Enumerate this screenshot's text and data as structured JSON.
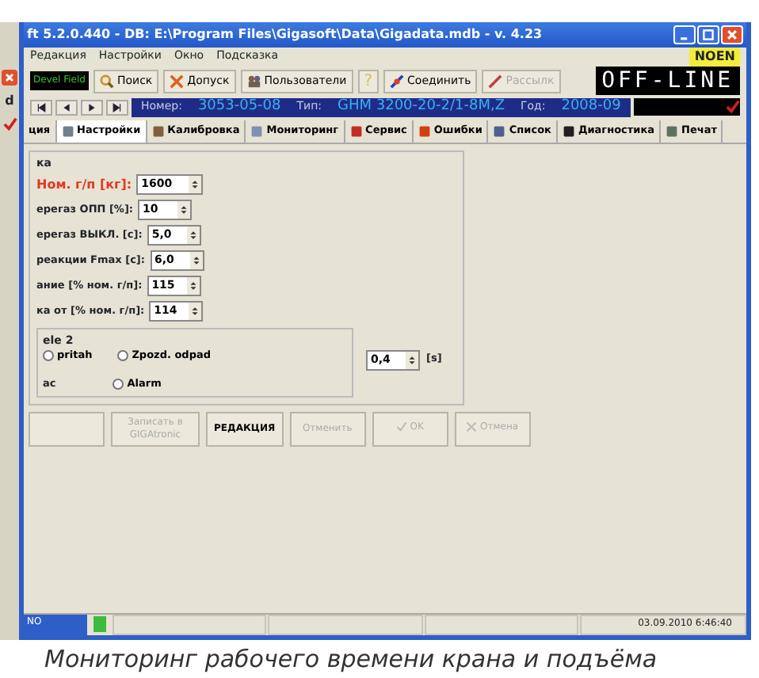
{
  "window": {
    "title": "ft 5.2.0.440 - DB: E:\\Program Files\\Gigasoft\\Data\\Gigadata.mdb - v. 4.23"
  },
  "background_window": {
    "text": "d"
  },
  "menu": [
    "Редакция",
    "Настройки",
    "Окно",
    "Подсказка"
  ],
  "badge": "NOEN",
  "toolbar": {
    "field": "Devel Field",
    "buttons": [
      {
        "label": "Поиск",
        "disabled": false
      },
      {
        "label": "Допуск",
        "disabled": false
      },
      {
        "label": "Пользователи",
        "disabled": false
      },
      {
        "label": "?",
        "disabled": true
      },
      {
        "label": "Соединить",
        "disabled": false
      },
      {
        "label": "Рассылк",
        "disabled": true
      }
    ]
  },
  "display": "OFF-LINE",
  "record": {
    "number_label": "Номер:",
    "number": "3053-05-08",
    "type_label": "Тип:",
    "type": "GHM 3200-20-2/1-8M,Z",
    "year_label": "Год:",
    "year": "2008-09"
  },
  "tabs": [
    {
      "label": "ция",
      "selected": false
    },
    {
      "label": "Настройки",
      "selected": true
    },
    {
      "label": "Калибровка",
      "selected": false
    },
    {
      "label": "Мониторинг",
      "selected": false
    },
    {
      "label": "Сервис",
      "selected": false
    },
    {
      "label": "Ошибки",
      "selected": false
    },
    {
      "label": "Список",
      "selected": false
    },
    {
      "label": "Диагностика",
      "selected": false
    },
    {
      "label": "Печат",
      "selected": false
    }
  ],
  "group": {
    "title": "ка",
    "fields": [
      {
        "label": "Ном. г/п [кг]:",
        "value": "1600",
        "highlight": true
      },
      {
        "label": "ерегаз ОПП [%]:",
        "value": "10",
        "highlight": false
      },
      {
        "label": "ерегаз ВЫКЛ. [с]:",
        "value": "5,0",
        "highlight": false
      },
      {
        "label": "реакции Fmax [с]:",
        "value": "6,0",
        "highlight": false
      },
      {
        "label": "ание [% ном. г/п]:",
        "value": "115",
        "highlight": false
      },
      {
        "label": "ка от [% ном. г/п]:",
        "value": "114",
        "highlight": false
      }
    ]
  },
  "relay": {
    "title": "ele 2",
    "row_label": "ac",
    "radios": [
      {
        "label": "pritah",
        "selected": false
      },
      {
        "label": "Zpozd. odpad",
        "selected": false
      },
      {
        "label": "Alarm",
        "selected": false
      }
    ],
    "delay": "0,4",
    "unit": "[s]"
  },
  "buttons": [
    {
      "label": "Записать в GIGAtronic",
      "disabled": true
    },
    {
      "label": "РЕДАКЦИЯ",
      "disabled": false
    },
    {
      "label": "Отменить",
      "disabled": true
    },
    {
      "label": "OK",
      "disabled": true
    },
    {
      "label": "Отмена",
      "disabled": true
    }
  ],
  "status_bar": {
    "mode": "NO",
    "connected": true,
    "datetime": "03.09.2010 6:46:40"
  },
  "caption": "Мониторинг рабочего времени крана и подъёма"
}
